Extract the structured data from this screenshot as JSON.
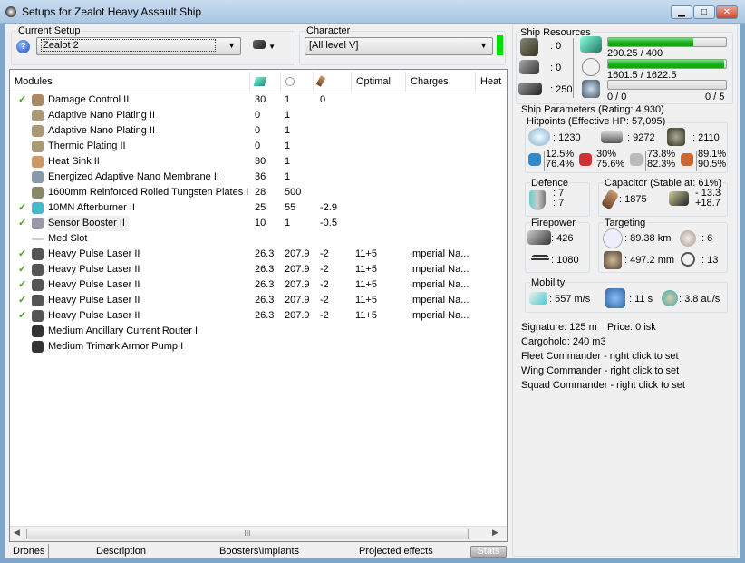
{
  "window": {
    "title": "Setups for Zealot Heavy Assault Ship",
    "buttons": [
      "minimize",
      "maximize",
      "close"
    ]
  },
  "setup": {
    "label": "Current Setup",
    "value": "Zealot 2",
    "help_icon": "help-icon",
    "ship_icon": "ship-dropdown-icon"
  },
  "character": {
    "label": "Character",
    "value": "[All level V]",
    "status_color": "#00e000"
  },
  "modules": {
    "headers": [
      "Modules",
      "cpu-icon",
      "powergrid-icon",
      "capacitor-icon",
      "Optimal",
      "Charges",
      "Heat"
    ],
    "rows": [
      {
        "active": true,
        "name": "Damage Control II",
        "cpu": "30",
        "pg": "1",
        "cap": "0",
        "optimal": "",
        "charges": ""
      },
      {
        "active": false,
        "name": "Adaptive Nano Plating II",
        "cpu": "0",
        "pg": "1",
        "cap": "",
        "optimal": "",
        "charges": ""
      },
      {
        "active": false,
        "name": "Adaptive Nano Plating II",
        "cpu": "0",
        "pg": "1",
        "cap": "",
        "optimal": "",
        "charges": ""
      },
      {
        "active": false,
        "name": "Thermic Plating II",
        "cpu": "0",
        "pg": "1",
        "cap": "",
        "optimal": "",
        "charges": ""
      },
      {
        "active": false,
        "name": "Heat Sink II",
        "cpu": "30",
        "pg": "1",
        "cap": "",
        "optimal": "",
        "charges": ""
      },
      {
        "active": false,
        "name": "Energized Adaptive Nano Membrane II",
        "cpu": "36",
        "pg": "1",
        "cap": "",
        "optimal": "",
        "charges": ""
      },
      {
        "active": false,
        "name": "1600mm Reinforced Rolled Tungsten Plates I",
        "cpu": "28",
        "pg": "500",
        "cap": "",
        "optimal": "",
        "charges": ""
      },
      {
        "active": true,
        "name": "10MN Afterburner II",
        "cpu": "25",
        "pg": "55",
        "cap": "-2.9",
        "optimal": "",
        "charges": ""
      },
      {
        "active": true,
        "name": "Sensor Booster II",
        "cpu": "10",
        "pg": "1",
        "cap": "-0.5",
        "optimal": "",
        "charges": ""
      },
      {
        "active": false,
        "name": "Med Slot",
        "cpu": "",
        "pg": "",
        "cap": "",
        "optimal": "",
        "charges": ""
      },
      {
        "active": true,
        "name": "Heavy Pulse Laser II",
        "cpu": "26.3",
        "pg": "207.9",
        "cap": "-2",
        "optimal": "11+5",
        "charges": "Imperial Na..."
      },
      {
        "active": true,
        "name": "Heavy Pulse Laser II",
        "cpu": "26.3",
        "pg": "207.9",
        "cap": "-2",
        "optimal": "11+5",
        "charges": "Imperial Na..."
      },
      {
        "active": true,
        "name": "Heavy Pulse Laser II",
        "cpu": "26.3",
        "pg": "207.9",
        "cap": "-2",
        "optimal": "11+5",
        "charges": "Imperial Na..."
      },
      {
        "active": true,
        "name": "Heavy Pulse Laser II",
        "cpu": "26.3",
        "pg": "207.9",
        "cap": "-2",
        "optimal": "11+5",
        "charges": "Imperial Na..."
      },
      {
        "active": true,
        "name": "Heavy Pulse Laser II",
        "cpu": "26.3",
        "pg": "207.9",
        "cap": "-2",
        "optimal": "11+5",
        "charges": "Imperial Na..."
      },
      {
        "active": false,
        "name": "Medium Ancillary Current Router I",
        "cpu": "",
        "pg": "",
        "cap": "",
        "optimal": "",
        "charges": ""
      },
      {
        "active": false,
        "name": "Medium Trimark Armor Pump I",
        "cpu": "",
        "pg": "",
        "cap": "",
        "optimal": "",
        "charges": ""
      }
    ]
  },
  "tabs": [
    "Drones",
    "Description",
    "Boosters\\Implants",
    "Projected effects",
    "Stats"
  ],
  "resources": {
    "title": "Ship Resources",
    "turret": ": 0",
    "launcher": ": 0",
    "drone_bay": ": 250",
    "cpu": "290.25 / 400",
    "cpu_fraction": 0.7256,
    "powergrid": "1601.5 / 1622.5",
    "powergrid_fraction": 0.987,
    "drone_bw": "0 / 0",
    "drones": "0 / 5",
    "drone_fraction": 0
  },
  "params": {
    "title": "Ship Parameters (Rating: 4,930)",
    "hitpoints": {
      "title": "Hitpoints (Effective HP: 57,095)",
      "shield": ": 1230",
      "armor": ": 9272",
      "structure": ": 2110",
      "resists": [
        [
          "12.5%",
          "76.4%"
        ],
        [
          "30%",
          "75.6%"
        ],
        [
          "73.8%",
          "82.3%"
        ],
        [
          "89.1%",
          "90.5%"
        ]
      ]
    },
    "defence": {
      "title": "Defence",
      "a": ": 7",
      "b": ": 7"
    },
    "capacitor": {
      "title": "Capacitor (Stable at: 61%)",
      "capacity": ": 1875",
      "delta1": "- 13.3",
      "delta2": "+18.7"
    },
    "firepower": {
      "title": "Firepower",
      "dps": ": 426",
      "volley": ": 1080"
    },
    "targeting": {
      "title": "Targeting",
      "range": ": 89.38 km",
      "targets": ": 6",
      "scan": ": 497.2 mm",
      "sensor": ": 13"
    },
    "mobility": {
      "title": "Mobility",
      "speed": ": 557 m/s",
      "align": ": 11 s",
      "warp": ": 3.8 au/s"
    },
    "signature": "Signature: 125 m",
    "price": "Price: 0 isk",
    "cargo": "Cargohold: 240 m3",
    "fleet": "Fleet Commander - right click to set",
    "wing": "Wing Commander - right click to set",
    "squad": "Squad Commander - right click to set"
  }
}
